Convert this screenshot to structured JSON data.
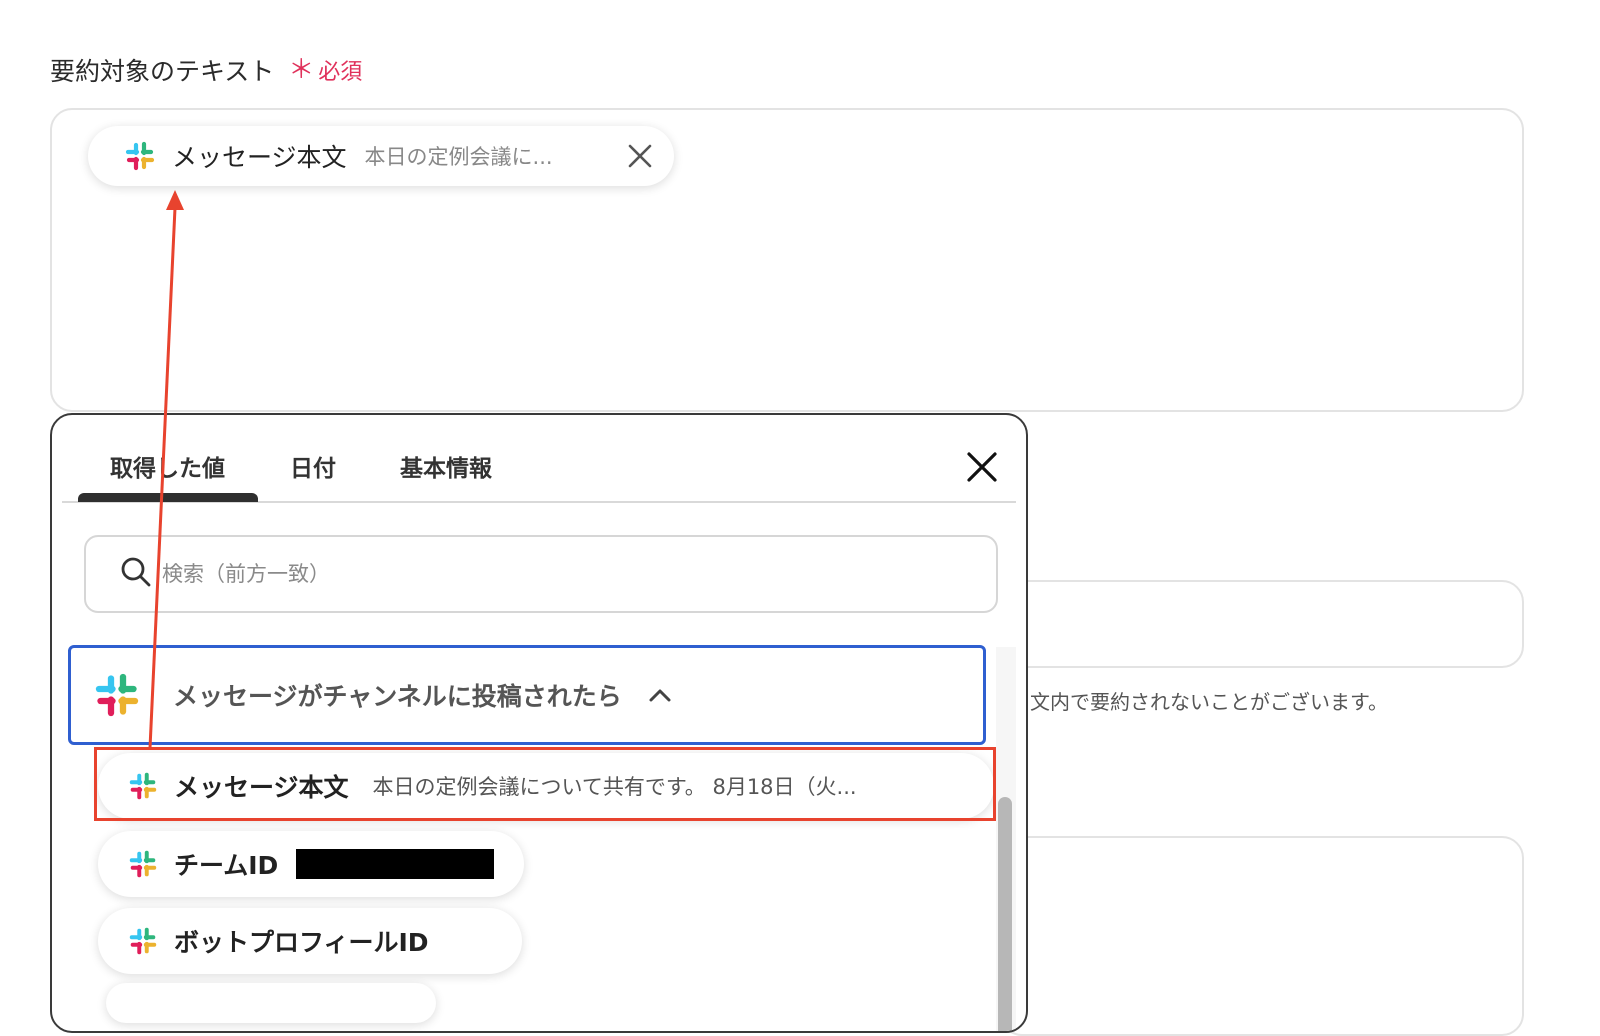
{
  "field": {
    "label": "要約対象のテキスト",
    "required_mark": "＊",
    "required_text": "必須"
  },
  "selected_chip": {
    "icon": "slack-icon",
    "name": "メッセージ本文",
    "preview": "本日の定例会議に..."
  },
  "background_note": "文内で要約されないことがございます。",
  "popup": {
    "tabs": [
      {
        "label": "取得した値",
        "active": true
      },
      {
        "label": "日付",
        "active": false
      },
      {
        "label": "基本情報",
        "active": false
      }
    ],
    "search": {
      "placeholder": "検索（前方一致）"
    },
    "group": {
      "icon": "slack-icon",
      "title": "メッセージがチャンネルに投稿されたら",
      "expanded": true
    },
    "items": [
      {
        "icon": "slack-icon",
        "name": "メッセージ本文",
        "preview": "本日の定例会議について共有です。 8月18日（火..."
      },
      {
        "icon": "slack-icon",
        "name": "チームID",
        "redacted": true
      },
      {
        "icon": "slack-icon",
        "name": "ボットプロフィールID"
      }
    ]
  },
  "colors": {
    "required": "#e0315b",
    "group_border": "#2f5fd0",
    "highlight": "#e8432e",
    "slack_red": "#e01e5a",
    "slack_blue": "#36c5f0",
    "slack_green": "#2eb67d",
    "slack_yellow": "#ecb22e"
  }
}
